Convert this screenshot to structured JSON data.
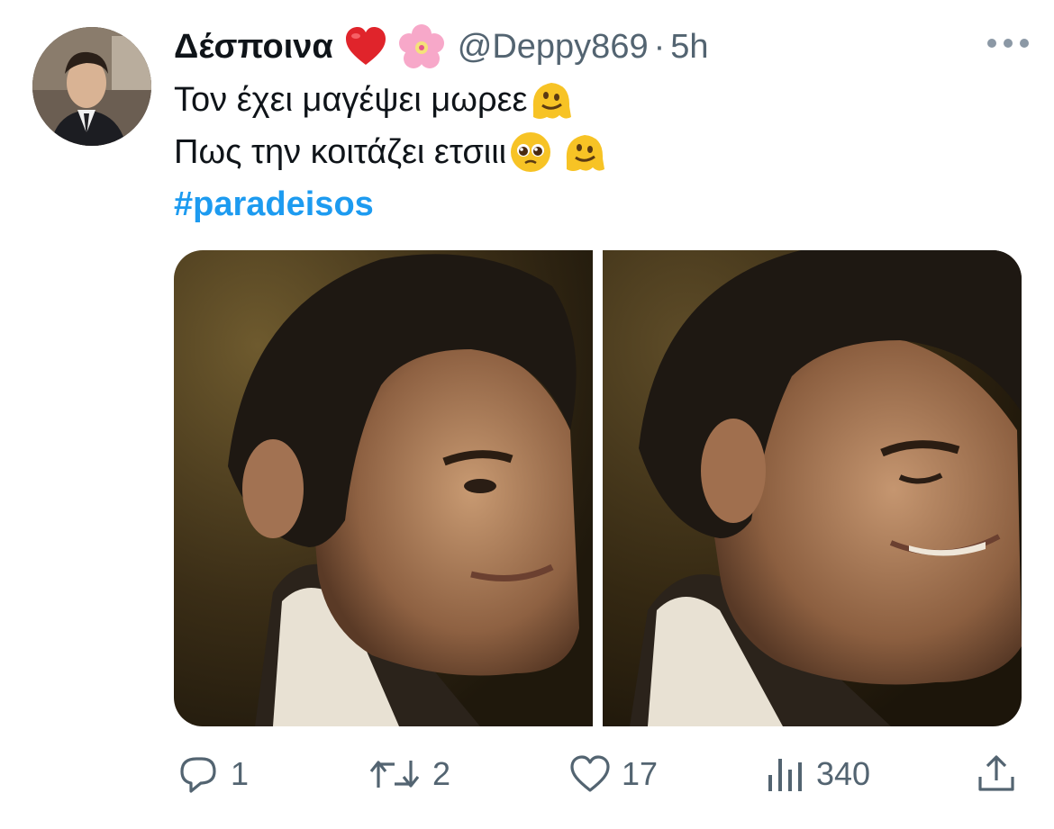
{
  "tweet": {
    "display_name": "Δέσποινα",
    "name_emojis": [
      "red-heart",
      "cherry-blossom"
    ],
    "handle": "@Deppy869",
    "separator": "·",
    "time": "5h",
    "lines": [
      {
        "text": "Τον έχει μαγέψει μωρεε",
        "emojis": [
          "melting-face"
        ]
      },
      {
        "text": "Πως την κοιτάζει ετσιιι",
        "emojis": [
          "pleading-face",
          "melting-face"
        ]
      }
    ],
    "hashtag": "#paradeisos",
    "media_count": 2
  },
  "actions": {
    "replies": "1",
    "retweets": "2",
    "likes": "17",
    "views": "340"
  },
  "colors": {
    "text": "#0f1419",
    "secondary": "#536471",
    "link": "#1d9bf0"
  }
}
